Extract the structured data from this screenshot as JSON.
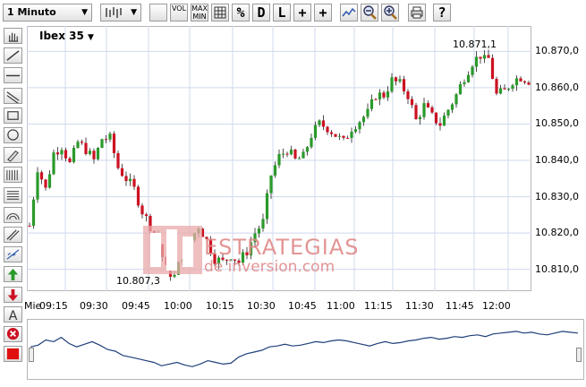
{
  "toolbar": {
    "timeframe": "1 Minuto",
    "buttons": [
      {
        "name": "chart-type-button",
        "label": ""
      },
      {
        "name": "volume-button",
        "label": "VOL"
      },
      {
        "name": "max-min-button",
        "label": "MAX\nMIN"
      },
      {
        "name": "grid-button",
        "label": ""
      },
      {
        "name": "percent-button",
        "label": "%"
      },
      {
        "name": "daily-button",
        "label": "D"
      },
      {
        "name": "log-button",
        "label": "L"
      },
      {
        "name": "crosshair-button",
        "label": "+"
      },
      {
        "name": "crosshair-label-button",
        "label": "+"
      },
      {
        "name": "compare-button",
        "label": ""
      },
      {
        "name": "zoom-out-button",
        "label": ""
      },
      {
        "name": "zoom-in-button",
        "label": ""
      },
      {
        "name": "print-button",
        "label": ""
      },
      {
        "name": "help-button",
        "label": "?"
      }
    ]
  },
  "left_tools": [
    "hand-icon",
    "line-icon",
    "horizontal-line-icon",
    "channel-icon",
    "rectangle-icon",
    "ellipse-icon",
    "pencil-icon",
    "fibonacci-icon",
    "grid-retracement-icon",
    "arc-icon",
    "parallel-lines-icon",
    "regression-icon",
    "arrow-up-icon",
    "arrow-down-icon",
    "text-icon",
    "delete-icon",
    "color-icon"
  ],
  "chart": {
    "instrument": "Ibex 35",
    "instrument_arrow": "▼",
    "max_annotation": "10.871,1",
    "min_annotation": "10.807,3",
    "watermark_line1": "ESTRATEGIAS",
    "watermark_line2": "de inversion.com",
    "colors": {
      "up": "#2a9a2a",
      "down": "#cc1122",
      "grid": "#cfd8ee",
      "nav_line": "#1f3f7a"
    }
  },
  "chart_data": {
    "type": "candlestick",
    "title": "Ibex 35",
    "yticks": [
      "10.870,0",
      "10.860,0",
      "10.850,0",
      "10.840,0",
      "10.830,0",
      "10.820,0",
      "10.810,0"
    ],
    "xticks": [
      "Mie",
      "09:15",
      "09:30",
      "09:45",
      "10:00",
      "10:15",
      "10:30",
      "10:45",
      "11:00",
      "11:15",
      "11:30",
      "11:45",
      "12:00"
    ],
    "ylim": [
      10804,
      10877
    ],
    "max": 10871.1,
    "min": 10807.3,
    "close_path_points": [
      [
        0,
        10822
      ],
      [
        2,
        10838
      ],
      [
        4,
        10832
      ],
      [
        6,
        10842
      ],
      [
        8,
        10844
      ],
      [
        10,
        10839
      ],
      [
        12,
        10845
      ],
      [
        14,
        10843
      ],
      [
        16,
        10840
      ],
      [
        18,
        10846
      ],
      [
        20,
        10846
      ],
      [
        22,
        10838
      ],
      [
        24,
        10835
      ],
      [
        26,
        10832
      ],
      [
        28,
        10826
      ],
      [
        30,
        10822
      ],
      [
        32,
        10817
      ],
      [
        34,
        10810
      ],
      [
        36,
        10808
      ],
      [
        38,
        10814
      ],
      [
        40,
        10818
      ],
      [
        42,
        10822
      ],
      [
        44,
        10818
      ],
      [
        46,
        10813
      ],
      [
        48,
        10812
      ],
      [
        50,
        10814
      ],
      [
        52,
        10812
      ],
      [
        54,
        10815
      ],
      [
        56,
        10820
      ],
      [
        58,
        10823
      ],
      [
        60,
        10836
      ],
      [
        62,
        10841
      ],
      [
        64,
        10843
      ],
      [
        66,
        10840
      ],
      [
        68,
        10841
      ],
      [
        70,
        10847
      ],
      [
        72,
        10850
      ],
      [
        74,
        10849
      ],
      [
        76,
        10847
      ],
      [
        78,
        10845
      ],
      [
        80,
        10849
      ],
      [
        82,
        10851
      ],
      [
        84,
        10853
      ],
      [
        86,
        10858
      ],
      [
        88,
        10858
      ],
      [
        90,
        10862
      ],
      [
        92,
        10861
      ],
      [
        94,
        10858
      ],
      [
        96,
        10851
      ],
      [
        98,
        10855
      ],
      [
        100,
        10852
      ],
      [
        102,
        10850
      ],
      [
        104,
        10854
      ],
      [
        106,
        10858
      ],
      [
        108,
        10863
      ],
      [
        110,
        10867
      ],
      [
        112,
        10869
      ],
      [
        114,
        10868
      ],
      [
        116,
        10858
      ],
      [
        118,
        10859
      ],
      [
        120,
        10862
      ],
      [
        122,
        10863
      ],
      [
        124,
        10862
      ]
    ],
    "grid": true
  }
}
